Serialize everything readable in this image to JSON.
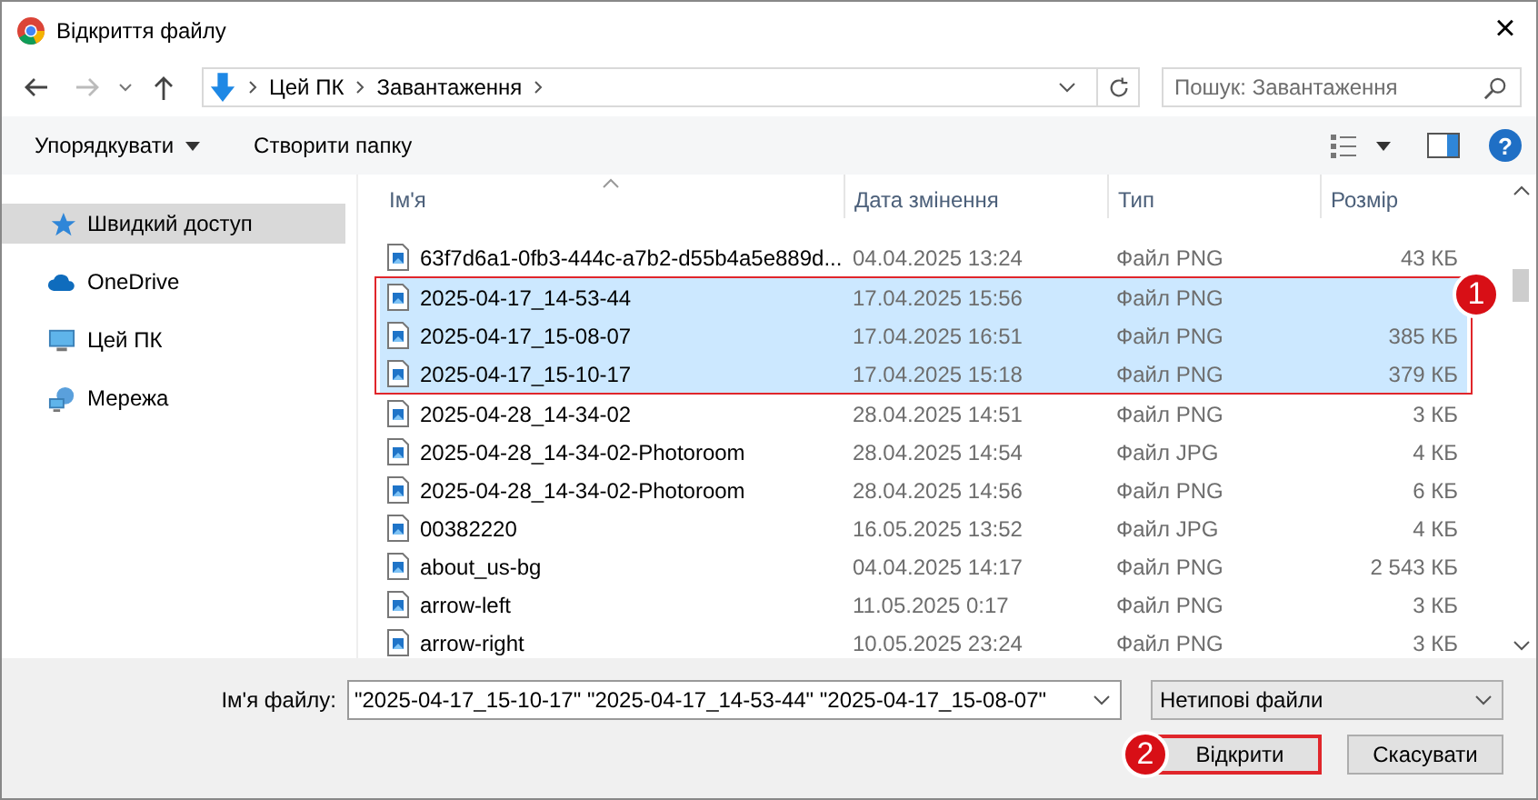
{
  "window": {
    "title": "Відкриття файлу",
    "close": "×"
  },
  "address_bar": {
    "path": [
      "Цей ПК",
      "Завантаження"
    ]
  },
  "search": {
    "placeholder": "Пошук: Завантаження"
  },
  "toolbar": {
    "organize": "Упорядкувати",
    "new_folder": "Створити папку",
    "help": "?"
  },
  "sidebar": {
    "items": [
      {
        "label": "Швидкий доступ",
        "kind": "star",
        "selected": true
      },
      {
        "label": "OneDrive",
        "kind": "cloud",
        "selected": false
      },
      {
        "label": "Цей ПК",
        "kind": "pc",
        "selected": false
      },
      {
        "label": "Мережа",
        "kind": "network",
        "selected": false
      }
    ]
  },
  "table": {
    "columns": [
      "Ім'я",
      "Дата змінення",
      "Тип",
      "Розмір"
    ],
    "rows": [
      {
        "name": "63f7d6a1-0fb3-444c-a7b2-d55b4a5e889d...",
        "date": "04.04.2025 13:24",
        "type": "Файл PNG",
        "size": "43 КБ",
        "selected": false
      },
      {
        "name": "2025-04-17_14-53-44",
        "date": "17.04.2025 15:56",
        "type": "Файл PNG",
        "selected": true
      },
      {
        "name": "2025-04-17_15-08-07",
        "date": "17.04.2025 16:51",
        "type": "Файл PNG",
        "size": "385 КБ",
        "selected": true
      },
      {
        "name": "2025-04-17_15-10-17",
        "date": "17.04.2025 15:18",
        "type": "Файл PNG",
        "size": "379 КБ",
        "selected": true
      },
      {
        "name": "2025-04-28_14-34-02",
        "date": "28.04.2025 14:51",
        "type": "Файл PNG",
        "size": "3 КБ",
        "selected": false
      },
      {
        "name": "2025-04-28_14-34-02-Photoroom",
        "date": "28.04.2025 14:54",
        "type": "Файл JPG",
        "size": "4 КБ",
        "selected": false
      },
      {
        "name": "2025-04-28_14-34-02-Photoroom",
        "date": "28.04.2025 14:56",
        "type": "Файл PNG",
        "size": "6 КБ",
        "selected": false
      },
      {
        "name": "00382220",
        "date": "16.05.2025 13:52",
        "type": "Файл JPG",
        "size": "4 КБ",
        "selected": false
      },
      {
        "name": "about_us-bg",
        "date": "04.04.2025 14:17",
        "type": "Файл PNG",
        "size": "2 543 КБ",
        "selected": false
      },
      {
        "name": "arrow-left",
        "date": "11.05.2025 0:17",
        "type": "Файл PNG",
        "size": "3 КБ",
        "selected": false
      },
      {
        "name": "arrow-right",
        "date": "10.05.2025 23:24",
        "type": "Файл PNG",
        "size": "3 КБ",
        "selected": false
      }
    ],
    "badge": "1"
  },
  "footer": {
    "filename_label": "Ім'я файлу:",
    "filename_value": "\"2025-04-17_15-10-17\" \"2025-04-17_14-53-44\" \"2025-04-17_15-08-07\"",
    "filter": "Нетипові файли",
    "buttons": [
      {
        "label": "Відкрити",
        "highlighted": true,
        "badge": "2"
      },
      {
        "label": "Скасувати",
        "highlighted": false
      }
    ]
  }
}
